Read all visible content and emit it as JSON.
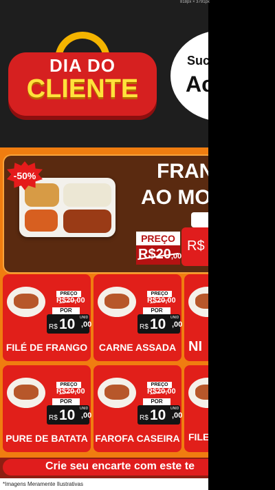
{
  "ruler": {
    "dimensions": "818px × 3791px"
  },
  "header": {
    "logo_line1": "DIA DO",
    "logo_line2": "CLIENTE",
    "bubble_line1": "Suc",
    "bubble_line2": "Ac"
  },
  "hero": {
    "discount_badge": "-50%",
    "title_line1": "FRAN",
    "title_line2": "AO MO",
    "preco_label": "PREÇO",
    "old_price_main": "R$20",
    "old_price_cents": ",00",
    "new_price_prefix": "R$"
  },
  "cards": [
    {
      "name": "FILÉ DE FRANGO",
      "preco_label": "PREÇO",
      "old_price": "R$20,00",
      "por_label": "POR",
      "currency": "R$",
      "price_int": "10",
      "price_cents": ",00",
      "unit": "UNID"
    },
    {
      "name": "CARNE ASSADA",
      "preco_label": "PREÇO",
      "old_price": "R$20,00",
      "por_label": "POR",
      "currency": "R$",
      "price_int": "10",
      "price_cents": ",00",
      "unit": "UNID"
    },
    {
      "name": "NI",
      "preco_label": "",
      "old_price": "",
      "por_label": "",
      "currency": "",
      "price_int": "",
      "price_cents": "",
      "unit": ""
    },
    {
      "name": "PURE DE BATATA",
      "preco_label": "PREÇO",
      "old_price": "R$20,00",
      "por_label": "POR",
      "currency": "R$",
      "price_int": "10",
      "price_cents": ",00",
      "unit": "UNID"
    },
    {
      "name": "FAROFA CASEIRA",
      "preco_label": "PREÇO",
      "old_price": "R$20,00",
      "por_label": "POR",
      "currency": "R$",
      "price_int": "10",
      "price_cents": ",00",
      "unit": "UNID"
    },
    {
      "name": "FILE",
      "preco_label": "",
      "old_price": "",
      "por_label": "",
      "currency": "",
      "price_int": "",
      "price_cents": "",
      "unit": ""
    }
  ],
  "cta": {
    "text": "Crie seu encarte com este te"
  },
  "footer": {
    "note": "*Imagens Meramente Ilustrativas"
  },
  "colors": {
    "orange": "#f07d10",
    "red": "#e11f1a",
    "dark": "#1c1c1c",
    "gold": "#ffe23b"
  }
}
